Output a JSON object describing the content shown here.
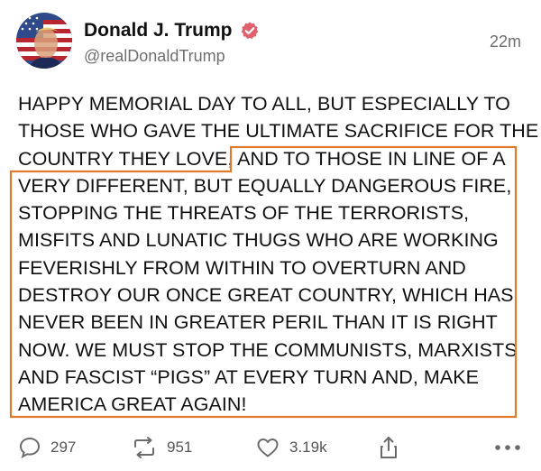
{
  "post": {
    "author_name": "Donald J. Trump",
    "handle": "@realDonaldTrump",
    "time": "22m",
    "lines": [
      "HAPPY MEMORIAL DAY TO ALL, BUT ESPECIALLY TO",
      "THOSE WHO GAVE THE ULTIMATE SACRIFICE FOR THE",
      "COUNTRY THEY LOVE, AND TO THOSE IN LINE OF A",
      "VERY DIFFERENT, BUT EQUALLY DANGEROUS FIRE,",
      "STOPPING THE THREATS OF THE TERRORISTS,",
      "MISFITS AND LUNATIC THUGS WHO ARE WORKING",
      "FEVERISHLY FROM WITHIN TO OVERTURN AND",
      "DESTROY OUR ONCE GREAT COUNTRY, WHICH HAS",
      "NEVER BEEN IN GREATER PERIL THAN IT IS RIGHT",
      "NOW. WE MUST STOP THE COMMUNISTS, MARXISTS",
      "AND FASCIST “PIGS” AT EVERY TURN AND, MAKE",
      "AMERICA GREAT AGAIN!"
    ]
  },
  "actions": {
    "reply_count": "297",
    "repost_count": "951",
    "like_count": "3.19k"
  },
  "icons": {
    "verified": "verified-badge-icon",
    "reply": "speech-bubble-icon",
    "repost": "repost-arrows-icon",
    "like": "heart-icon",
    "share": "share-upload-icon",
    "more": "ellipsis-icon"
  },
  "colors": {
    "highlight": "#e07a2c",
    "verified_badge": "#e0606e",
    "muted_text": "#6f6f6f"
  }
}
